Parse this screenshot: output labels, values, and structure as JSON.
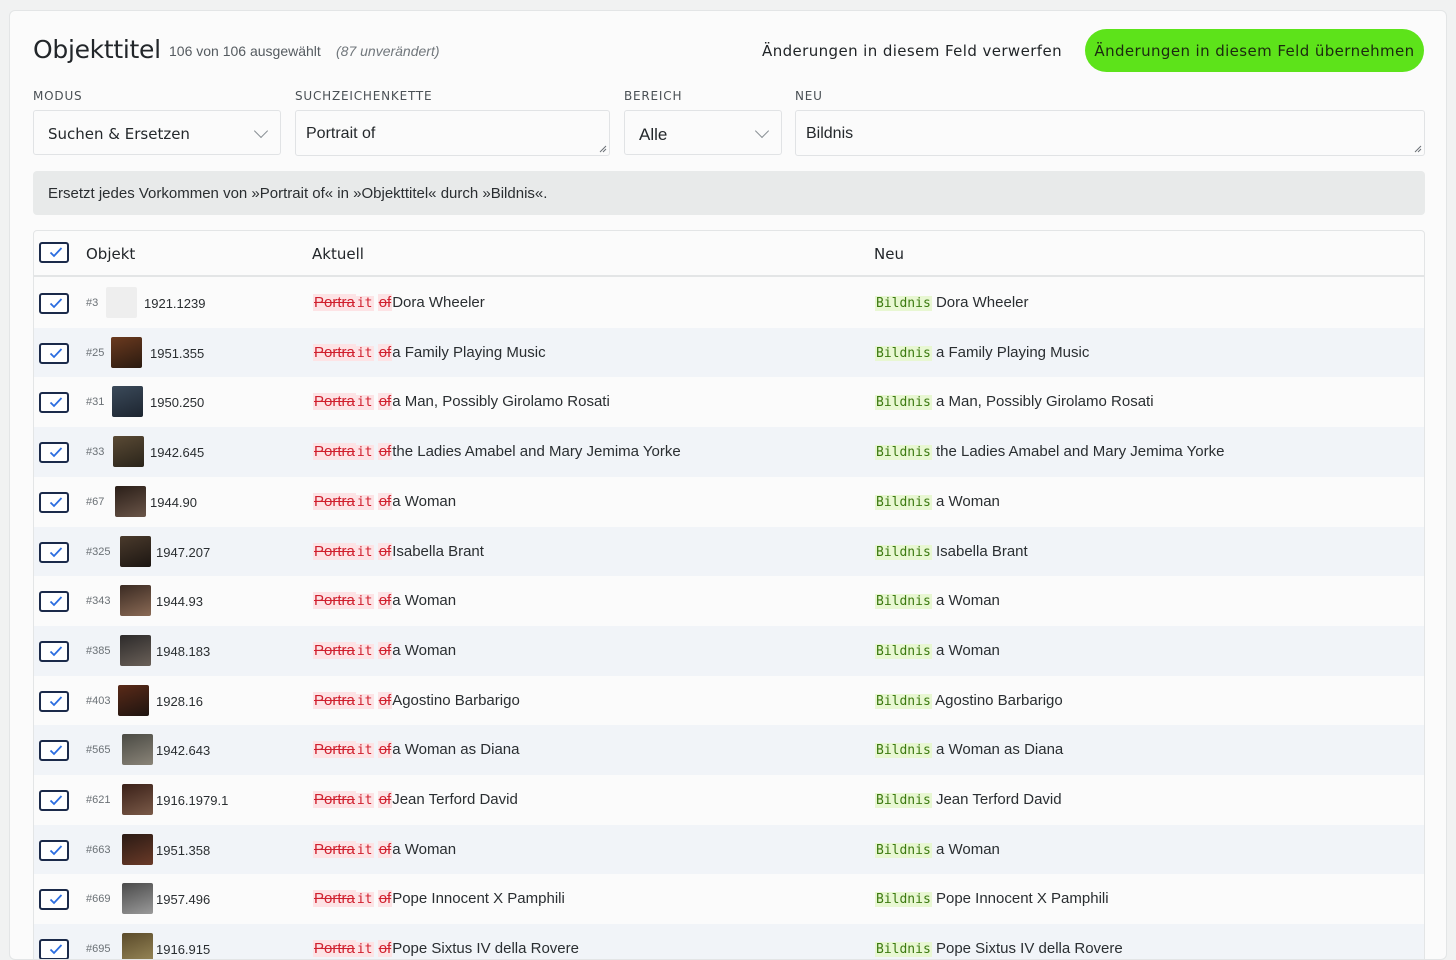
{
  "header": {
    "title": "Objekttitel",
    "selection_count": "106 von 106 ausgewählt",
    "unchanged_note": "(87 unverändert)",
    "discard_label": "Änderungen in diesem Feld verwerfen",
    "apply_label": "Änderungen in diesem Feld übernehmen",
    "apply_color": "#5de31a"
  },
  "fields": {
    "mode_label": "MODUS",
    "mode_value": "Suchen & Ersetzen",
    "search_label": "SUCHZEICHENKETTE",
    "search_value": "Portrait of",
    "scope_label": "BEREICH",
    "scope_value": "Alle",
    "new_label": "NEU",
    "new_value": "Bildnis"
  },
  "info_text": "Ersetzt jedes Vorkommen von »Portrait of« in »Objekttitel« durch »Bildnis«.",
  "table": {
    "col_object": "Objekt",
    "col_current": "Aktuell",
    "col_new": "Neu",
    "rows": [
      {
        "id": "#3",
        "inv": "1921.1239",
        "rest": "Dora Wheeler"
      },
      {
        "id": "#25",
        "inv": "1951.355",
        "rest": "a Family Playing Music"
      },
      {
        "id": "#31",
        "inv": "1950.250",
        "rest": "a Man, Possibly Girolamo Rosati"
      },
      {
        "id": "#33",
        "inv": "1942.645",
        "rest": "the Ladies Amabel and Mary Jemima Yorke"
      },
      {
        "id": "#67",
        "inv": "1944.90",
        "rest": "a Woman"
      },
      {
        "id": "#325",
        "inv": "1947.207",
        "rest": "Isabella Brant"
      },
      {
        "id": "#343",
        "inv": "1944.93",
        "rest": "a Woman"
      },
      {
        "id": "#385",
        "inv": "1948.183",
        "rest": "a Woman"
      },
      {
        "id": "#403",
        "inv": "1928.16",
        "rest": "Agostino Barbarigo"
      },
      {
        "id": "#565",
        "inv": "1942.643",
        "rest": "a Woman as Diana"
      },
      {
        "id": "#621",
        "inv": "1916.1979.1",
        "rest": "Jean Terford David"
      },
      {
        "id": "#663",
        "inv": "1951.358",
        "rest": "a Woman"
      },
      {
        "id": "#669",
        "inv": "1957.496",
        "rest": "Pope Innocent X Pamphili"
      },
      {
        "id": "#695",
        "inv": "1916.915",
        "rest": "Pope Sixtus IV della Rovere"
      }
    ],
    "diff": {
      "del_a": "Portra",
      "keep": "it",
      "del_b": "of",
      "ins": "Bildnis"
    }
  }
}
